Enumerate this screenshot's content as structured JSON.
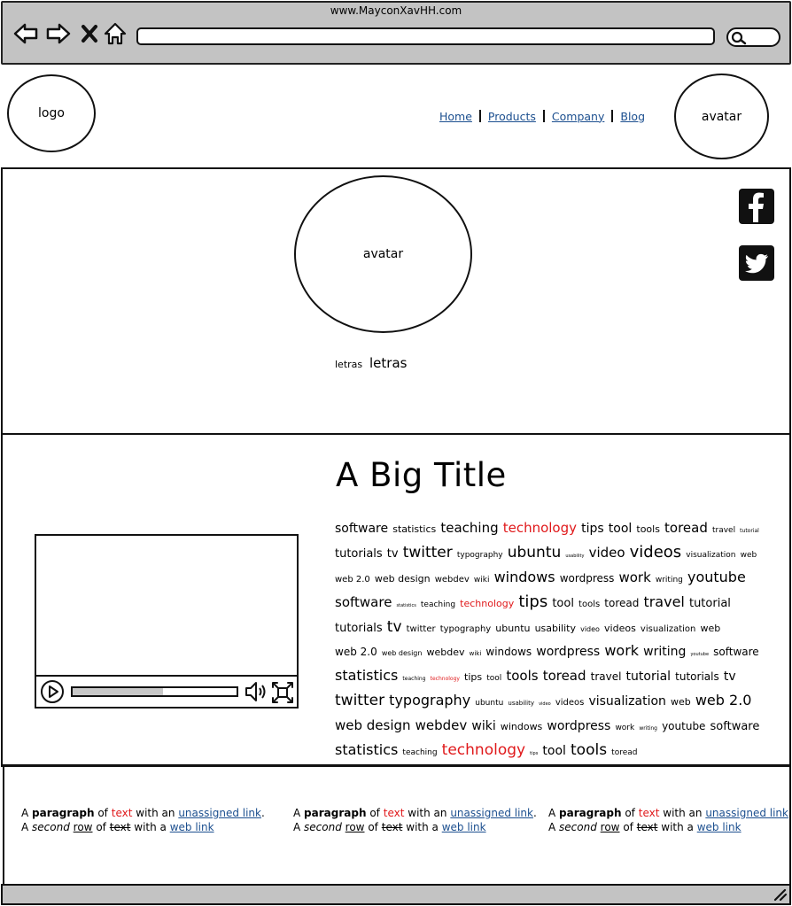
{
  "browser": {
    "url": "www.MayconXavHH.com",
    "address_value": "",
    "search_value": ""
  },
  "header": {
    "logo": "logo",
    "avatar": "avatar",
    "nav": [
      {
        "label": "Home"
      },
      {
        "label": "Products"
      },
      {
        "label": "Company"
      },
      {
        "label": "Blog"
      }
    ]
  },
  "profile": {
    "avatar": "avatar",
    "caption_small": "letras",
    "caption_big": "letras",
    "social": [
      "facebook-icon",
      "twitter-icon"
    ]
  },
  "content": {
    "title": "A Big Title",
    "video": {
      "progress": 0.55
    },
    "tags": [
      {
        "t": "software",
        "s": 14
      },
      {
        "t": "statistics",
        "s": 11
      },
      {
        "t": "teaching",
        "s": 15
      },
      {
        "t": "technology",
        "s": 15,
        "c": "red"
      },
      {
        "t": "tips",
        "s": 14
      },
      {
        "t": "tool",
        "s": 14
      },
      {
        "t": "tools",
        "s": 11
      },
      {
        "t": "toread",
        "s": 15
      },
      {
        "t": "travel",
        "s": 9
      },
      {
        "t": "tutorial",
        "s": 6
      },
      {
        "t": "tutorials",
        "s": 13
      },
      {
        "t": "tv",
        "s": 13
      },
      {
        "t": "twitter",
        "s": 17
      },
      {
        "t": "typography",
        "s": 9
      },
      {
        "t": "ubuntu",
        "s": 17
      },
      {
        "t": "usability",
        "s": 5
      },
      {
        "t": "video",
        "s": 15
      },
      {
        "t": "videos",
        "s": 18
      },
      {
        "t": "visualization",
        "s": 9
      },
      {
        "t": "web",
        "s": 9
      },
      {
        "t": "web 2.0",
        "s": 10
      },
      {
        "t": "web design",
        "s": 11
      },
      {
        "t": "webdev",
        "s": 10
      },
      {
        "t": "wiki",
        "s": 9
      },
      {
        "t": "windows",
        "s": 16
      },
      {
        "t": "wordpress",
        "s": 12
      },
      {
        "t": "work",
        "s": 15
      },
      {
        "t": "writing",
        "s": 9
      },
      {
        "t": "youtube",
        "s": 16
      },
      {
        "t": "software",
        "s": 15
      },
      {
        "t": "statistics",
        "s": 5
      },
      {
        "t": "teaching",
        "s": 9
      },
      {
        "t": "technology",
        "s": 11,
        "c": "red"
      },
      {
        "t": "tips",
        "s": 18
      },
      {
        "t": "tool",
        "s": 13
      },
      {
        "t": "tools",
        "s": 10
      },
      {
        "t": "toread",
        "s": 12
      },
      {
        "t": "travel",
        "s": 16
      },
      {
        "t": "tutorial",
        "s": 13
      },
      {
        "t": "tutorials",
        "s": 13
      },
      {
        "t": "tv",
        "s": 17
      },
      {
        "t": "twitter",
        "s": 10
      },
      {
        "t": "typography",
        "s": 10
      },
      {
        "t": "ubuntu",
        "s": 11
      },
      {
        "t": "usability",
        "s": 11
      },
      {
        "t": "video",
        "s": 8
      },
      {
        "t": "videos",
        "s": 11
      },
      {
        "t": "visualization",
        "s": 10
      },
      {
        "t": "web",
        "s": 11
      },
      {
        "t": "web 2.0",
        "s": 12
      },
      {
        "t": "web design",
        "s": 8
      },
      {
        "t": "webdev",
        "s": 11
      },
      {
        "t": "wiki",
        "s": 7
      },
      {
        "t": "windows",
        "s": 12
      },
      {
        "t": "wordpress",
        "s": 14
      },
      {
        "t": "work",
        "s": 16
      },
      {
        "t": "writing",
        "s": 14
      },
      {
        "t": "youtube",
        "s": 5
      },
      {
        "t": "software",
        "s": 12
      },
      {
        "t": "statistics",
        "s": 16
      },
      {
        "t": "teaching",
        "s": 6
      },
      {
        "t": "technology",
        "s": 6,
        "c": "red"
      },
      {
        "t": "tips",
        "s": 11
      },
      {
        "t": "tool",
        "s": 9
      },
      {
        "t": "tools",
        "s": 15
      },
      {
        "t": "toread",
        "s": 15
      },
      {
        "t": "travel",
        "s": 12
      },
      {
        "t": "tutorial",
        "s": 14
      },
      {
        "t": "tutorials",
        "s": 12
      },
      {
        "t": "tv",
        "s": 14
      },
      {
        "t": "twitter",
        "s": 17
      },
      {
        "t": "typography",
        "s": 16
      },
      {
        "t": "ubuntu",
        "s": 9
      },
      {
        "t": "usability",
        "s": 7
      },
      {
        "t": "video",
        "s": 5
      },
      {
        "t": "videos",
        "s": 10
      },
      {
        "t": "visualization",
        "s": 14
      },
      {
        "t": "web",
        "s": 11
      },
      {
        "t": "web 2.0",
        "s": 16
      },
      {
        "t": "web design",
        "s": 15
      },
      {
        "t": "webdev",
        "s": 15
      },
      {
        "t": "wiki",
        "s": 14
      },
      {
        "t": "windows",
        "s": 11
      },
      {
        "t": "wordpress",
        "s": 14
      },
      {
        "t": "work",
        "s": 9
      },
      {
        "t": "writing",
        "s": 6
      },
      {
        "t": "youtube",
        "s": 12
      },
      {
        "t": "software",
        "s": 13
      },
      {
        "t": "statistics",
        "s": 16
      },
      {
        "t": "teaching",
        "s": 9
      },
      {
        "t": "technology",
        "s": 17,
        "c": "red"
      },
      {
        "t": "tips",
        "s": 5
      },
      {
        "t": "tool",
        "s": 14
      },
      {
        "t": "tools",
        "s": 17
      },
      {
        "t": "toread",
        "s": 9
      }
    ]
  },
  "footer": {
    "paragraph": {
      "w1": "A",
      "bold": "paragraph",
      "w2": "of",
      "red": "text",
      "w3": "with an",
      "link1": "unassigned link",
      "end": ".",
      "w4": "A",
      "italic": "second",
      "ul": "row",
      "w5": "of",
      "strike": "text",
      "w6": "with a",
      "link2": "web link"
    }
  },
  "colors": {
    "chrome": "#c3c3c3",
    "link": "#1c4f8f",
    "accent_red": "#e0191b"
  }
}
